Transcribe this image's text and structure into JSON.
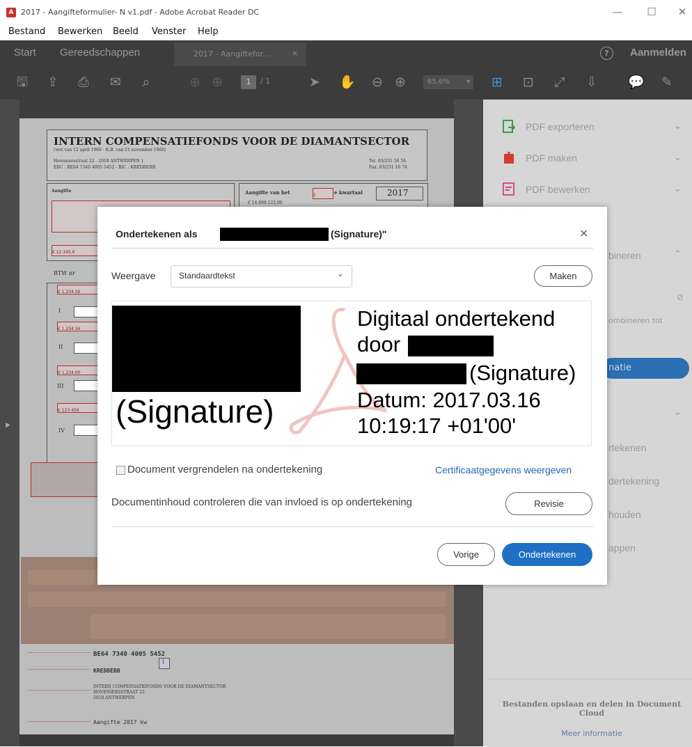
{
  "titlebar": {
    "title": "2017 - Aangifteformulier- N v1.pdf - Adobe Acrobat Reader DC",
    "minimize": "—",
    "maximize": "☐",
    "close": "✕"
  },
  "menu": [
    "Bestand",
    "Bewerken",
    "Beeld",
    "Venster",
    "Help"
  ],
  "tabs": {
    "start": "Start",
    "tools": "Gereedschappen",
    "document": "2017 - Aangiftefor...",
    "close": "×",
    "help": "?",
    "signin": "Aanmelden"
  },
  "toolbar": {
    "page_current": "1",
    "page_total": "/ 1",
    "zoom": "65,6%"
  },
  "document": {
    "title": "INTERN COMPENSATIEFONDS VOOR DE DIAMANTSECTOR",
    "subtitle": "(wet van 12 april 1960 - K.B. van 21 november 1960)",
    "address": "Hoveniersstraat 22 - 2018 ANTWERPEN 1",
    "bank": "EBC : BE64 7340 4005 5452 - BIC : KREDBEBB",
    "tel": "Tel. 03/231 56 56",
    "fax": "Fax. 03/231 16 74",
    "aangifte_label": "Aangifte",
    "quarter_label": "Aangifte van het",
    "quarter_value": "1",
    "quarter_suffix": "e kwartaal",
    "year": "2017",
    "amount1": "€ 14.600.122,00",
    "amount_left": "€ 12.345.6",
    "btw": "BTW nr",
    "fields": [
      "€ 1.234.56",
      "€ 1.234.56",
      "€ 1.234.00",
      "€ 123.456"
    ],
    "roman": [
      "I",
      "II",
      "III",
      "IV"
    ],
    "iban": "BE64  7340  4005  5452",
    "bic": "KREDBEBB",
    "payee1": "INTERN COMPENSATIEFONDS VOOR DE DIAMANTSECTOR",
    "payee2": "HOVENIERSSTRAAT 22",
    "payee3": "2018 ANTWERPEN",
    "comm": "Aangifte  2017  kw",
    "mini_value": "1"
  },
  "rightpane": {
    "items": [
      {
        "label": "PDF exporteren",
        "color": "#3f9a49"
      },
      {
        "label": "PDF maken",
        "color": "#cf3d33"
      },
      {
        "label": "PDF bewerken",
        "color": "#cf4f8c"
      }
    ],
    "combine_fragment": "bineren",
    "combine_text": "ombineren tot",
    "blue_button": "natie",
    "tool_fragments": [
      "rtekenen",
      "dertekening",
      "houden",
      "appen"
    ],
    "cloud_title": "Bestanden opslaan en delen in Document Cloud",
    "cloud_link": "Meer informatie"
  },
  "dialog": {
    "title_prefix": "Ondertekenen als",
    "title_suffix": "(Signature)\"",
    "close": "×",
    "weergave_label": "Weergave",
    "weergave_value": "Standaardtekst",
    "make_button": "Maken",
    "preview": {
      "big_name": "(Signature)",
      "line1": "Digitaal ondertekend",
      "line2": "door",
      "line3": "(Signature)",
      "line4": "Datum: 2017.03.16",
      "line5": "10:19:17 +01'00'"
    },
    "lock_label": "Document vergrendelen na ondertekening",
    "cert_link": "Certificaatgegevens weergeven",
    "review_label": "Documentinhoud controleren die van invloed is op ondertekening",
    "review_button": "Revisie",
    "back_button": "Vorige",
    "sign_button": "Ondertekenen",
    "accent": "#1f6fc4"
  }
}
